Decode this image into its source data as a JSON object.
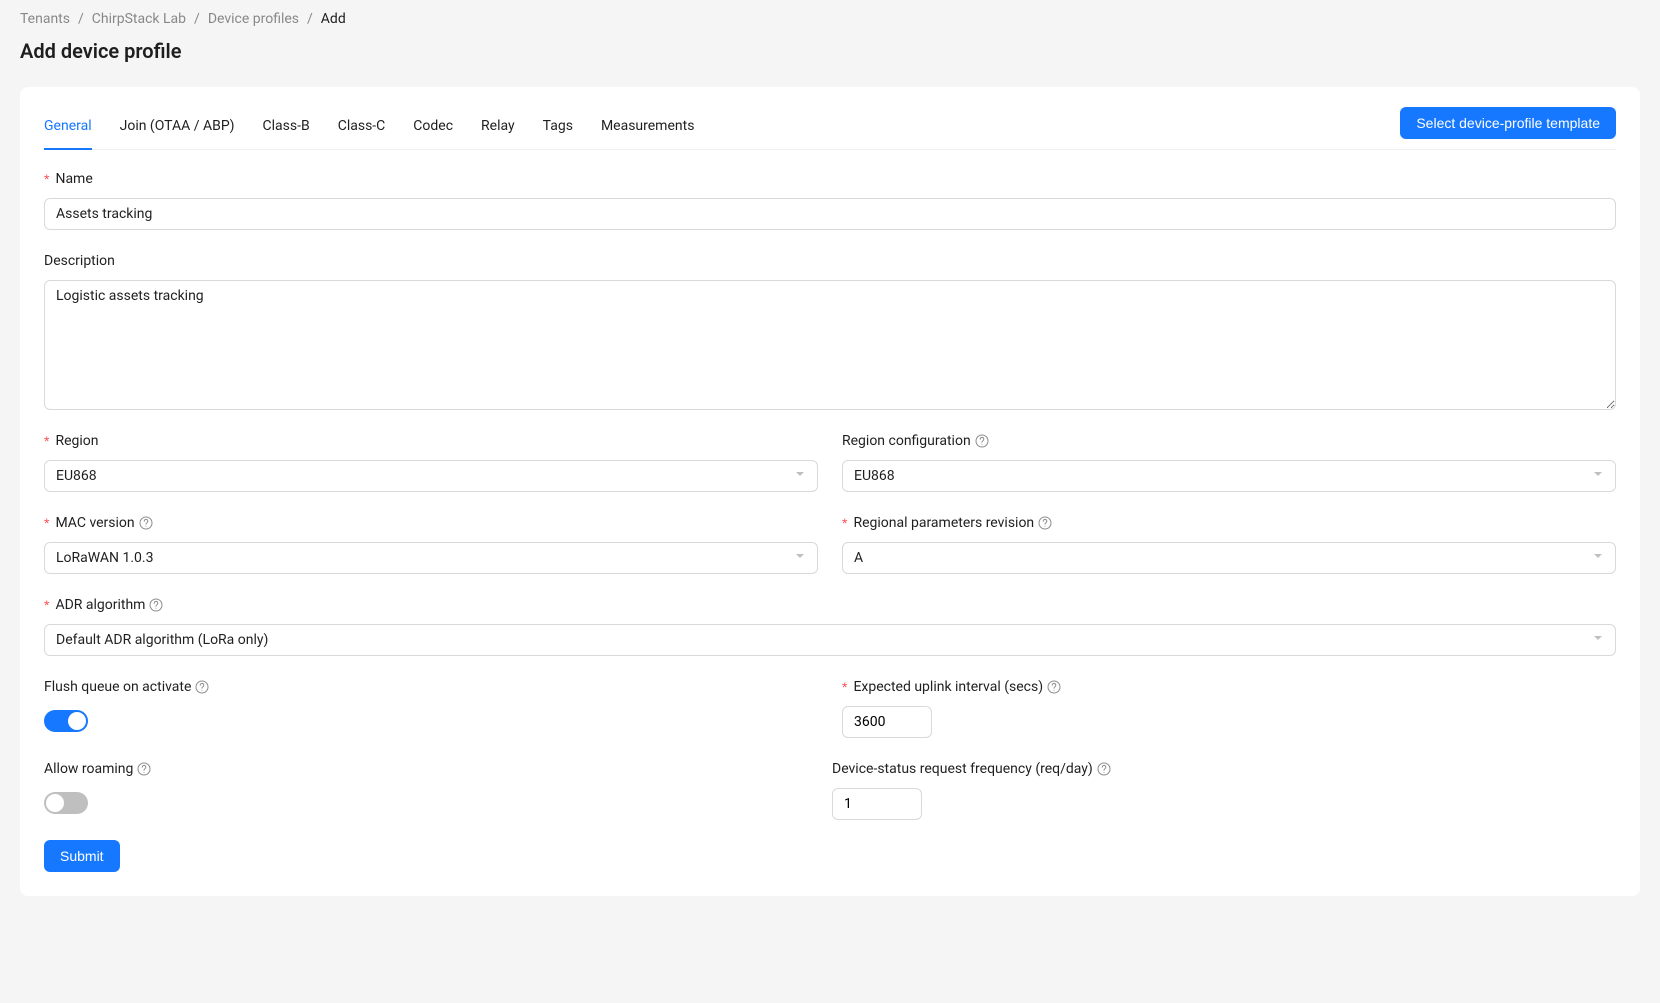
{
  "breadcrumb": {
    "items": [
      "Tenants",
      "ChirpStack Lab",
      "Device profiles",
      "Add"
    ]
  },
  "page_title": "Add device profile",
  "tabs": [
    {
      "label": "General",
      "active": true
    },
    {
      "label": "Join (OTAA / ABP)",
      "active": false
    },
    {
      "label": "Class-B",
      "active": false
    },
    {
      "label": "Class-C",
      "active": false
    },
    {
      "label": "Codec",
      "active": false
    },
    {
      "label": "Relay",
      "active": false
    },
    {
      "label": "Tags",
      "active": false
    },
    {
      "label": "Measurements",
      "active": false
    }
  ],
  "template_button": "Select device-profile template",
  "form": {
    "name": {
      "label": "Name",
      "required": true,
      "value": "Assets tracking"
    },
    "description": {
      "label": "Description",
      "required": false,
      "value": "Logistic assets tracking"
    },
    "region": {
      "label": "Region",
      "required": true,
      "value": "EU868"
    },
    "region_config": {
      "label": "Region configuration",
      "required": false,
      "value": "EU868",
      "help": true
    },
    "mac_version": {
      "label": "MAC version",
      "required": true,
      "value": "LoRaWAN 1.0.3",
      "help": true
    },
    "regional_params": {
      "label": "Regional parameters revision",
      "required": true,
      "value": "A",
      "help": true
    },
    "adr_algorithm": {
      "label": "ADR algorithm",
      "required": true,
      "value": "Default ADR algorithm (LoRa only)",
      "help": true
    },
    "flush_queue": {
      "label": "Flush queue on activate",
      "required": false,
      "value": true,
      "help": true
    },
    "uplink_interval": {
      "label": "Expected uplink interval (secs)",
      "required": true,
      "value": "3600",
      "help": true
    },
    "allow_roaming": {
      "label": "Allow roaming",
      "required": false,
      "value": false,
      "help": true
    },
    "device_status_freq": {
      "label": "Device-status request frequency (req/day)",
      "required": false,
      "value": "1",
      "help": true
    }
  },
  "submit_label": "Submit"
}
